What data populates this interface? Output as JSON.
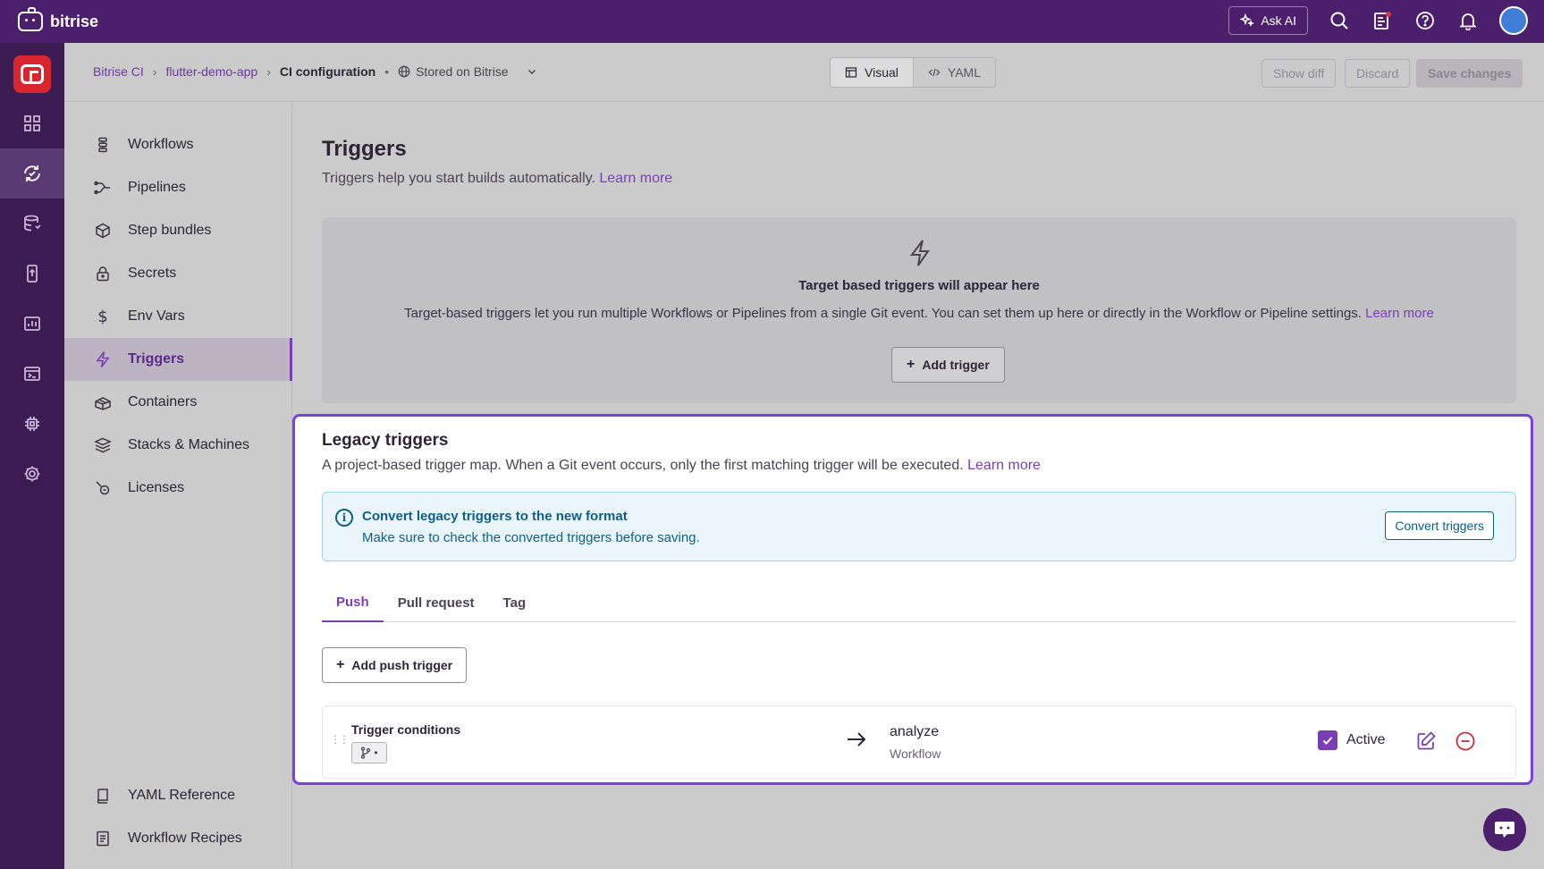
{
  "brand": {
    "name": "bitrise"
  },
  "topbar": {
    "ask_ai": "Ask AI",
    "icons": [
      "search-icon",
      "changelog-icon",
      "help-icon",
      "bell-icon",
      "user-avatar"
    ]
  },
  "rail": {
    "items": [
      "dashboard-icon",
      "ci-icon",
      "build-cache-icon",
      "release-icon",
      "insights-icon",
      "terminal-icon",
      "chip-icon",
      "settings-icon"
    ],
    "active": "ci-icon"
  },
  "breadcrumb": {
    "items": [
      "Bitrise CI",
      "flutter-demo-app"
    ],
    "current": "CI configuration",
    "stored": "Stored on Bitrise"
  },
  "view_switch": {
    "visual": "Visual",
    "yaml": "YAML"
  },
  "header_actions": {
    "show_diff": "Show diff",
    "discard": "Discard",
    "save": "Save changes"
  },
  "nav": {
    "items": [
      {
        "label": "Workflows",
        "icon": "workflows-icon"
      },
      {
        "label": "Pipelines",
        "icon": "pipelines-icon"
      },
      {
        "label": "Step bundles",
        "icon": "step-bundles-icon"
      },
      {
        "label": "Secrets",
        "icon": "lock-icon"
      },
      {
        "label": "Env Vars",
        "icon": "dollar-icon"
      },
      {
        "label": "Triggers",
        "icon": "bolt-icon",
        "active": true
      },
      {
        "label": "Containers",
        "icon": "containers-icon"
      },
      {
        "label": "Stacks & Machines",
        "icon": "stack-icon"
      },
      {
        "label": "Licenses",
        "icon": "licenses-icon"
      }
    ],
    "bottom": [
      {
        "label": "YAML Reference",
        "icon": "book-icon"
      },
      {
        "label": "Workflow Recipes",
        "icon": "recipes-icon"
      }
    ]
  },
  "page": {
    "title": "Triggers",
    "subtitle": "Triggers help you start builds automatically.",
    "learn_more": "Learn more"
  },
  "target": {
    "title": "Target based triggers will appear here",
    "description": "Target-based triggers let you run multiple Workflows or Pipelines from a single Git event. You can set them up here or directly in the Workflow or Pipeline settings.",
    "learn_more": "Learn more",
    "add_trigger": "Add trigger"
  },
  "legacy": {
    "title": "Legacy triggers",
    "subtitle": "A project-based trigger map. When a Git event occurs, only the first matching trigger will be executed.",
    "learn_more": "Learn more",
    "banner": {
      "title": "Convert legacy triggers to the new format",
      "description": "Make sure to check the converted triggers before saving.",
      "button": "Convert triggers"
    },
    "tabs": [
      "Push",
      "Pull request",
      "Tag"
    ],
    "active_tab": "Push",
    "add_push": "Add push trigger",
    "row": {
      "conditions_label": "Trigger conditions",
      "chip_dot": "•",
      "workflow_name": "analyze",
      "workflow_type": "Workflow",
      "active_label": "Active",
      "active": true
    }
  },
  "colors": {
    "topbar": "#4b1f6b",
    "rail": "#3b1b52",
    "accent": "#7a3fb5",
    "highlight": "#7b3fe4",
    "info": "#0b5f8a",
    "danger": "#d12a3a"
  }
}
